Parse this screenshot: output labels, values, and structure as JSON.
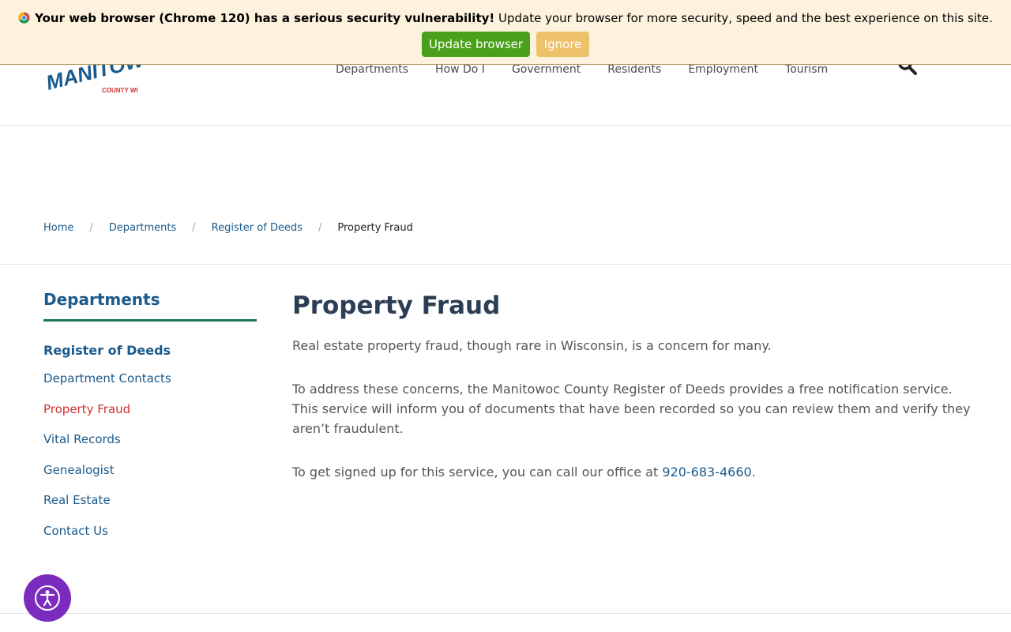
{
  "banner": {
    "bold_text": "Your web browser (Chrome 120) has a serious security vulnerability!",
    "text": "Update your browser for more security, speed and the best experience on this site.",
    "update_label": "Update browser",
    "ignore_label": "Ignore",
    "icon": "chrome-icon"
  },
  "header": {
    "logo_text": "MANITOWOC",
    "logo_subtext": "COUNTY WI",
    "nav": [
      "Departments",
      "How Do I",
      "Government",
      "Residents",
      "Employment",
      "Tourism"
    ],
    "search_icon": "search-icon"
  },
  "breadcrumb": {
    "items": [
      "Home",
      "Departments",
      "Register of Deeds"
    ],
    "separator": "/",
    "current": "Property Fraud"
  },
  "sidebar": {
    "title": "Departments",
    "subtitle": "Register of Deeds",
    "items": [
      "Department Contacts",
      "Property Fraud",
      "Vital Records",
      "Genealogist",
      "Real Estate",
      "Contact Us"
    ],
    "active_item": "Property Fraud"
  },
  "main": {
    "title": "Property Fraud",
    "p1": "Real estate property fraud, though rare in Wisconsin, is a concern for many.",
    "p2_line1": "To address these concerns, the Manitowoc County Register of Deeds provides a free notification service.",
    "p2_line2": "This service will inform you of documents that have been recorded so you can review them and verify they aren’t fraudulent.",
    "p3_prefix": "To get signed up for this service, you can call our office at ",
    "p3_phone": "920-683-4660",
    "p3_suffix": "."
  },
  "accessibility": {
    "icon": "accessibility-icon"
  },
  "colors": {
    "link": "#1a5a8c",
    "active": "#d0312d",
    "accent_rule": "#1a7a55",
    "banner_bg": "#fdf2dd",
    "update_btn": "#4aa01a",
    "ignore_btn": "#eec16b",
    "a11y": "#7b2cbf"
  }
}
